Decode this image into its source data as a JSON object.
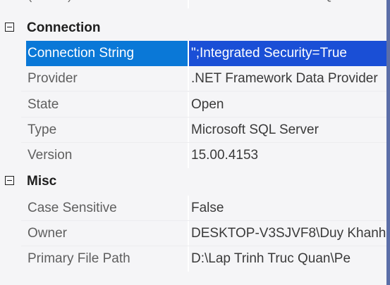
{
  "top_row": {
    "name": "(Name)",
    "value": "D:\\LAP TRINH TRUC QUAN"
  },
  "sections": {
    "connection": {
      "label": "Connection",
      "rows": [
        {
          "name": "Connection String",
          "value": "\";Integrated Security=True"
        },
        {
          "name": "Provider",
          "value": ".NET Framework Data Provider"
        },
        {
          "name": "State",
          "value": "Open"
        },
        {
          "name": "Type",
          "value": "Microsoft SQL Server"
        },
        {
          "name": "Version",
          "value": "15.00.4153"
        }
      ]
    },
    "misc": {
      "label": "Misc",
      "rows": [
        {
          "name": "Case Sensitive",
          "value": "False"
        },
        {
          "name": "Owner",
          "value": "DESKTOP-V3SJVF8\\Duy Khanh"
        },
        {
          "name": "Primary File Path",
          "value": "D:\\Lap Trinh Truc Quan\\Pe"
        }
      ]
    }
  },
  "colors": {
    "selection_name_bg": "#0a78d7",
    "selection_value_bg": "#1a4fd6",
    "grid_bg": "#f5f5f7"
  },
  "icons": {
    "collapse": "minus-box-icon"
  }
}
